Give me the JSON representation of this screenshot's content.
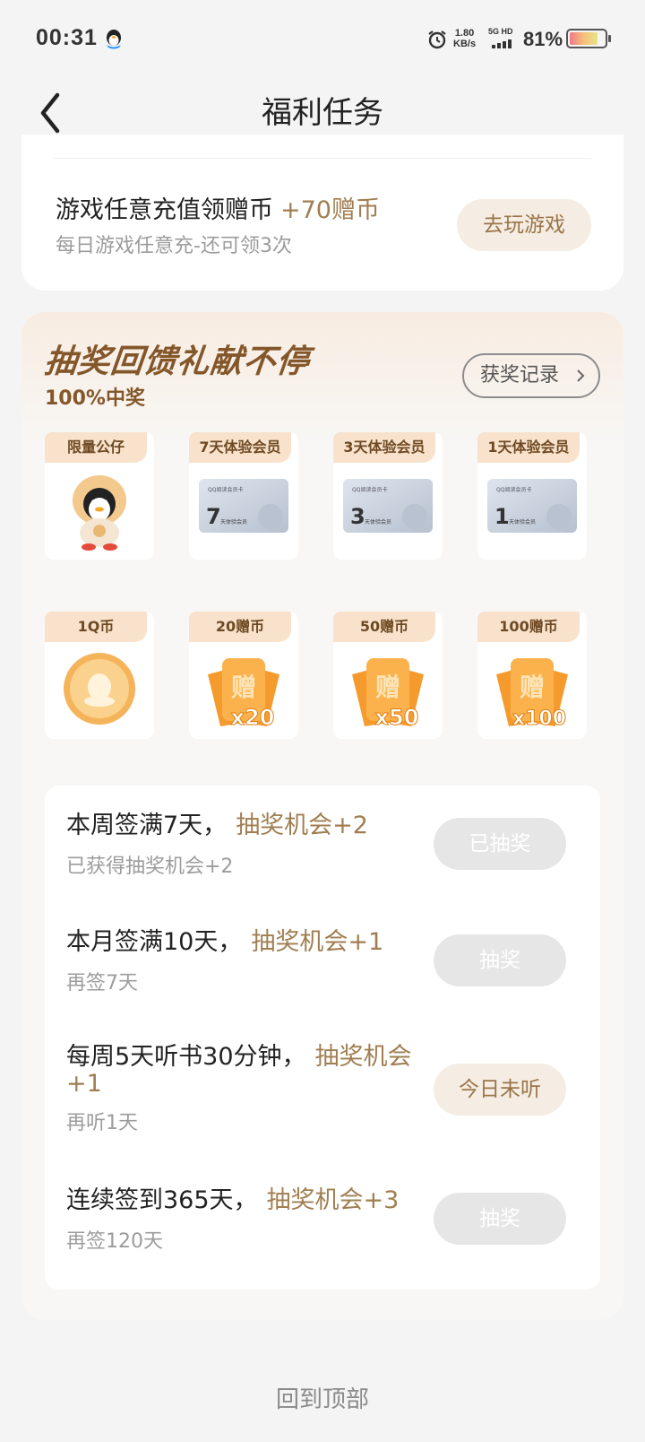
{
  "status": {
    "time": "00:31",
    "net_speed_value": "1.80",
    "net_speed_unit": "KB/s",
    "network": "5G HD",
    "battery": "81%"
  },
  "nav": {
    "title": "福利任务"
  },
  "top_task": {
    "title": "游戏任意充值领赠币",
    "reward": "+70赠币",
    "subtitle": "每日游戏任意充-还可领3次",
    "button": "去玩游戏"
  },
  "lottery": {
    "title": "抽奖回馈礼献不停",
    "subtitle": "100%中奖",
    "record_button": "获奖记录",
    "prizes": [
      {
        "label": "限量公仔",
        "icon": "penguin-doll-icon"
      },
      {
        "label": "7天体验会员",
        "icon": "member-card-icon",
        "card_days": "7",
        "card_brand": "QQ阅读会员卡",
        "card_text": "天体验会员"
      },
      {
        "label": "3天体验会员",
        "icon": "member-card-icon",
        "card_days": "3",
        "card_brand": "QQ阅读会员卡",
        "card_text": "天体验会员"
      },
      {
        "label": "1天体验会员",
        "icon": "member-card-icon",
        "card_days": "1",
        "card_brand": "QQ阅读会员卡",
        "card_text": "天体验会员"
      },
      {
        "label": "1Q币",
        "icon": "q-coin-icon"
      },
      {
        "label": "20赠币",
        "icon": "gift-coin-icon",
        "glyph": "赠",
        "count": "x20"
      },
      {
        "label": "50赠币",
        "icon": "gift-coin-icon",
        "glyph": "赠",
        "count": "x50"
      },
      {
        "label": "100赠币",
        "icon": "gift-coin-icon",
        "glyph": "赠",
        "count": "x100"
      }
    ],
    "tasks": [
      {
        "title": "本周签满7天，",
        "reward": "抽奖机会+2",
        "sub": "已获得抽奖机会+2",
        "button": "已抽奖",
        "state": "disabled"
      },
      {
        "title": "本月签满10天，",
        "reward": "抽奖机会+1",
        "sub": "再签7天",
        "button": "抽奖",
        "state": "disabled"
      },
      {
        "title": "每周5天听书30分钟，",
        "reward": "抽奖机会+1",
        "sub": "再听1天",
        "button": "今日未听",
        "state": "active"
      },
      {
        "title": "连续签到365天，",
        "reward": "抽奖机会+3",
        "sub": "再签120天",
        "button": "抽奖",
        "state": "disabled"
      }
    ]
  },
  "footer": {
    "back_to_top": "回到顶部"
  },
  "colors": {
    "accent": "#a07e51",
    "tag_bg": "#f8e2cc",
    "title_brown": "#84572b"
  }
}
